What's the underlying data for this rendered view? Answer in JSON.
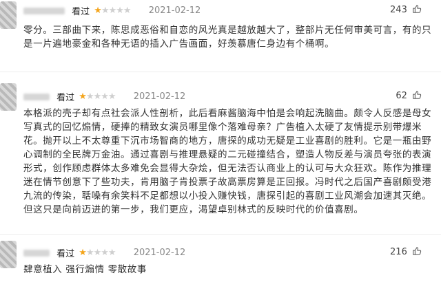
{
  "reviews": [
    {
      "status": "看过",
      "rating": 1,
      "max_rating": 5,
      "date": "2021-02-12",
      "votes": "243",
      "content": "零分。三部曲下来，陈思成恶俗和自恋的风光真是越放越大了，整部片无任何审美可言，有的只是一片遍地豪金和各种无语的插入广告画面，好羡慕唐仁身边有个桶啊。"
    },
    {
      "status": "看过",
      "rating": 1,
      "max_rating": 5,
      "date": "2021-02-12",
      "votes": "62",
      "content": "本格派的壳子却有点社会派人性剖析，此后看麻酱脑海中怕是会响起洗脑曲。颇令人反感是母女写真式的回忆煽情，硬捧的精致女演员哪里像个落难母亲？广告植入太硬了友情提示别带爆米花。抛开以上不太尊重下沉市场智商的地方，唐探的成功无疑是工业喜剧的胜利。它是一瓶由野心调制的全民牌万金油。通过喜剧与推理悬疑的二元碰撞结合，塑造人物反差与演员夸张的表演形式，创作顾虑群体太多难免会显得大杂烩，但无法否认商业上的认可与大众狂欢。陈作为推理迷在情节创意下了些功夫，肯用脑子肯投票子故高票房算是正回报。冯时代之后国产喜剧颇受港九流的传染，聒噪有余笑料不足都想以小投入赚快钱，唐探引起的喜剧工业风潮会加速其灭绝。但这只是向前迈进的第一步，我们更应，渴望卓别林式的反映时代的价值喜剧。"
    },
    {
      "status": "看过",
      "rating": 1,
      "max_rating": 5,
      "date": "2021-02-12",
      "votes": "216",
      "content": "肆意植入 强行煽情 零散故事"
    }
  ],
  "colors": {
    "star_on": "#f4a51c",
    "star_off": "#cfcfcf",
    "date": "#888888"
  },
  "icons": {
    "vote": "thumb-up-icon"
  }
}
